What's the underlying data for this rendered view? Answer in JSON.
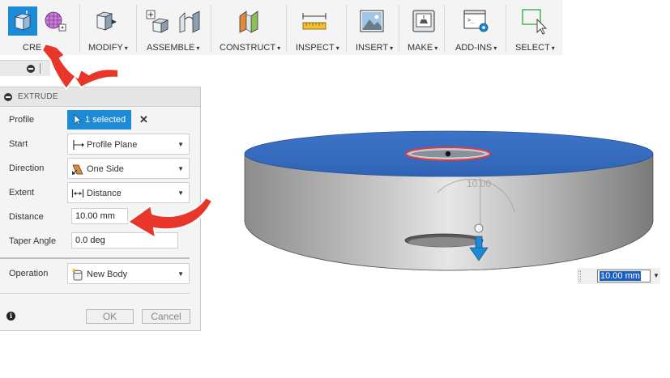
{
  "toolbar": {
    "groups": [
      {
        "label": "CRE",
        "caret": false
      },
      {
        "label": "MODIFY",
        "caret": true
      },
      {
        "label": "ASSEMBLE",
        "caret": true
      },
      {
        "label": "CONSTRUCT",
        "caret": true
      },
      {
        "label": "INSPECT",
        "caret": true
      },
      {
        "label": "INSERT",
        "caret": true
      },
      {
        "label": "MAKE",
        "caret": true
      },
      {
        "label": "ADD-INS",
        "caret": true
      },
      {
        "label": "SELECT",
        "caret": true
      }
    ],
    "caret_glyph": "▾",
    "accent": "#1d8ad6"
  },
  "panel": {
    "title": "EXTRUDE",
    "rows": {
      "profile": {
        "label": "Profile",
        "button": "1 selected",
        "clear": "✕"
      },
      "start": {
        "label": "Start",
        "value": "Profile Plane",
        "icon": "profile-plane-icon"
      },
      "direction": {
        "label": "Direction",
        "value": "One Side",
        "icon": "one-side-icon"
      },
      "extent": {
        "label": "Extent",
        "value": "Distance",
        "icon": "distance-icon"
      },
      "distance": {
        "label": "Distance",
        "value": "10.00 mm"
      },
      "taper": {
        "label": "Taper Angle",
        "value": "0.0 deg"
      },
      "operation": {
        "label": "Operation",
        "value": "New Body",
        "icon": "new-body-icon"
      }
    },
    "info": "i",
    "ok_label": "OK",
    "cancel_label": "Cancel"
  },
  "viewport": {
    "dimension_label": "10.00",
    "dimension_input": "10.00 mm",
    "top_face_color": "#3a6fc4",
    "side_color": "#a8a8a8"
  },
  "annotations": {
    "arrow_color": "#e8372a"
  }
}
